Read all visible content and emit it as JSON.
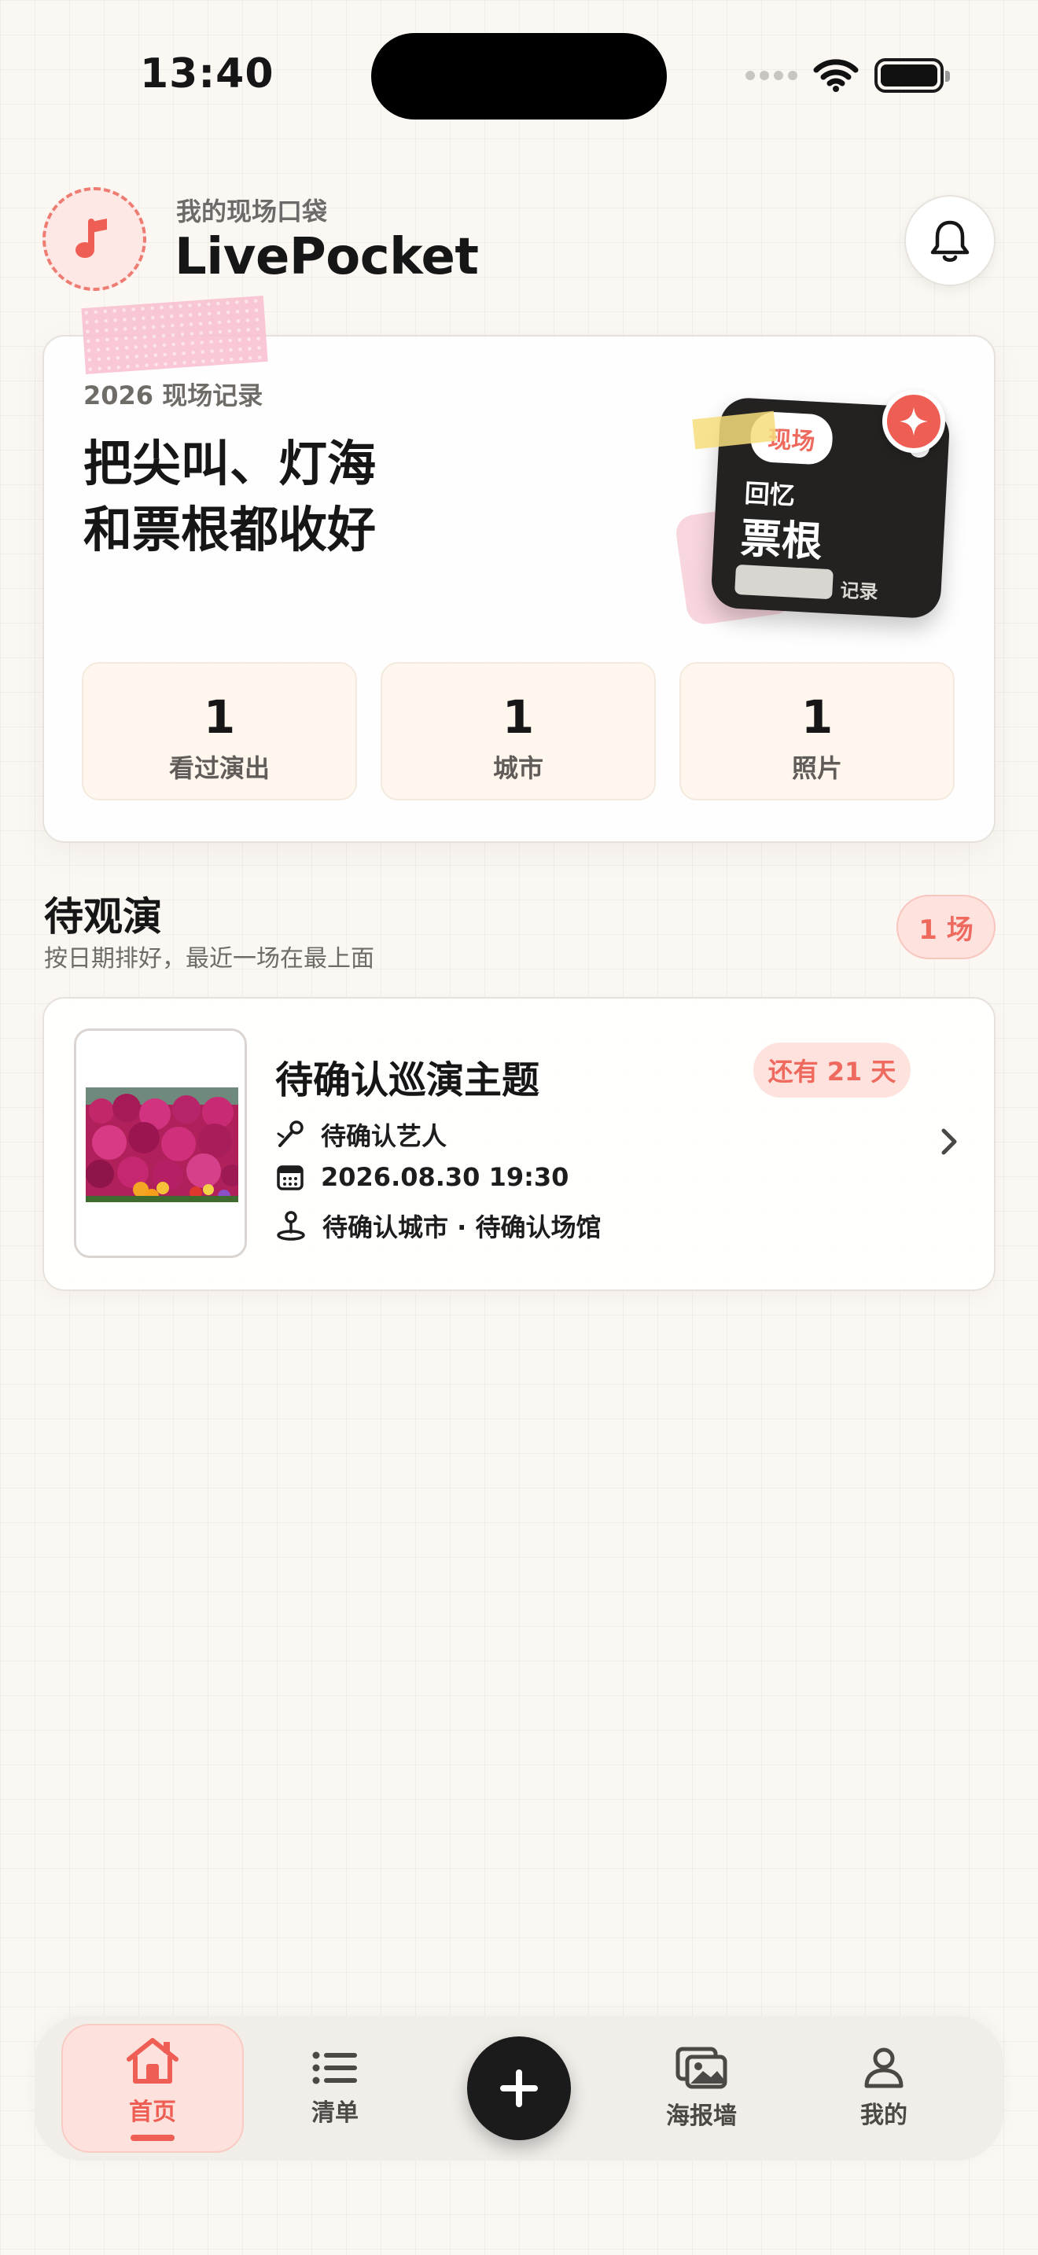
{
  "status_bar": {
    "time": "13:40"
  },
  "header": {
    "kicker": "我的现场口袋",
    "title": "LivePocket"
  },
  "hero": {
    "kicker": "2026 现场记录",
    "headline_line1": "把尖叫、灯海",
    "headline_line2": "和票根都收好",
    "ticket": {
      "pill": "现场",
      "small": "回忆",
      "big": "票根",
      "tag": "记录"
    },
    "stats": [
      {
        "value": "1",
        "label": "看过演出"
      },
      {
        "value": "1",
        "label": "城市"
      },
      {
        "value": "1",
        "label": "照片"
      }
    ]
  },
  "upcoming": {
    "title": "待观演",
    "subtitle": "按日期排好，最近一场在最上面",
    "count_badge": "1 场",
    "shows": [
      {
        "title": "待确认巡演主题",
        "countdown": "还有 21 天",
        "artist": "待确认艺人",
        "datetime": "2026.08.30 19:30",
        "location": "待确认城市 · 待确认场馆"
      }
    ]
  },
  "tabs": [
    {
      "label": "首页",
      "icon": "home-icon",
      "active": true
    },
    {
      "label": "清单",
      "icon": "list-icon",
      "active": false
    },
    {
      "label": "",
      "icon": "plus-icon",
      "active": false
    },
    {
      "label": "海报墙",
      "icon": "photo-wall-icon",
      "active": false
    },
    {
      "label": "我的",
      "icon": "person-icon",
      "active": false
    }
  ],
  "colors": {
    "accent": "#ef5e54",
    "accent_soft": "#fde2de",
    "background": "#fbf8f4",
    "ticket_dark": "#232221",
    "stat_tile": "#fff7ee"
  }
}
